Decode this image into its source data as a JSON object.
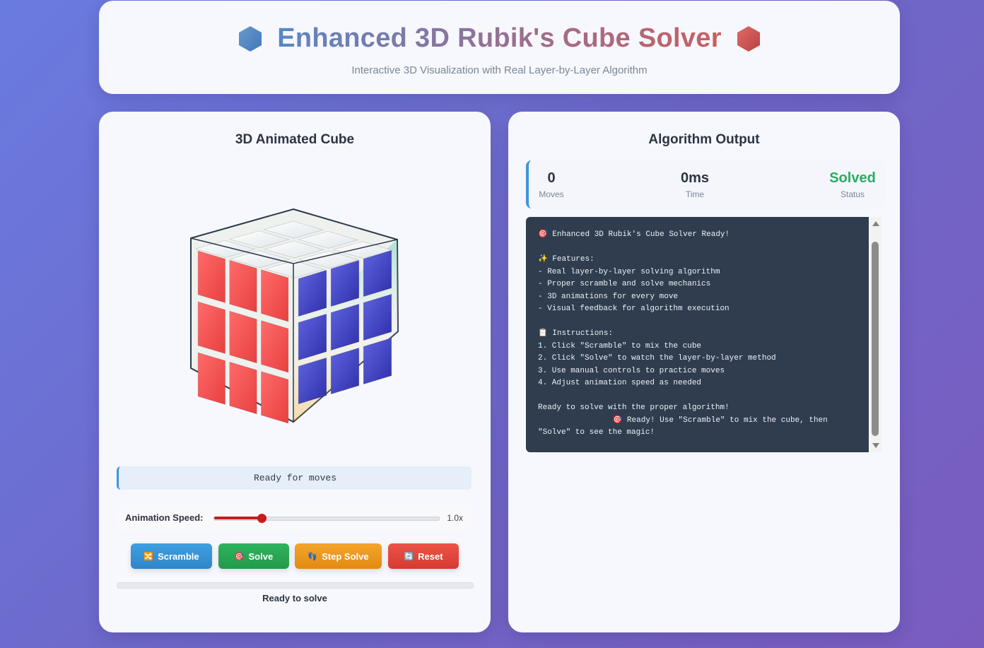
{
  "header": {
    "title": "Enhanced 3D Rubik's Cube Solver",
    "subtitle": "Interactive 3D Visualization with Real Layer-by-Layer Algorithm",
    "left_icon": "blue-hexagon-icon",
    "right_icon": "red-hexagon-icon"
  },
  "left_panel": {
    "title": "3D Animated Cube",
    "status_text": "Ready for moves",
    "speed": {
      "label": "Animation Speed:",
      "value_text": "1.0x",
      "fraction": 0.21
    },
    "buttons": {
      "scramble": {
        "icon": "🔀",
        "label": "Scramble"
      },
      "solve": {
        "icon": "🎯",
        "label": "Solve"
      },
      "step_solve": {
        "icon": "👣",
        "label": "Step Solve"
      },
      "reset": {
        "icon": "🔄",
        "label": "Reset"
      }
    },
    "progress": {
      "fraction": 0,
      "label": "Ready to solve"
    }
  },
  "right_panel": {
    "title": "Algorithm Output",
    "stats": {
      "moves": {
        "value": "0",
        "label": "Moves"
      },
      "time": {
        "value": "0ms",
        "label": "Time"
      },
      "status": {
        "value": "Solved",
        "label": "Status"
      }
    },
    "console_lines": [
      "🎯 Enhanced 3D Rubik's Cube Solver Ready!",
      "",
      "✨ Features:",
      "- Real layer-by-layer solving algorithm",
      "- Proper scramble and solve mechanics",
      "- 3D animations for every move",
      "- Visual feedback for algorithm execution",
      "",
      "📋 Instructions:",
      "1. Click \"Scramble\" to mix the cube",
      "2. Click \"Solve\" to watch the layer-by-layer method",
      "3. Use manual controls to practice moves",
      "4. Adjust animation speed as needed",
      "",
      "Ready to solve with the proper algorithm!",
      "                🎯 Ready! Use \"Scramble\" to mix the cube, then",
      "\"Solve\" to see the magic!"
    ]
  },
  "colors": {
    "front": "#f0504f",
    "right": "#3b3fc4",
    "top": "#ffffff",
    "accent_blue": "#3d97d6",
    "solved_green": "#27ae60"
  }
}
